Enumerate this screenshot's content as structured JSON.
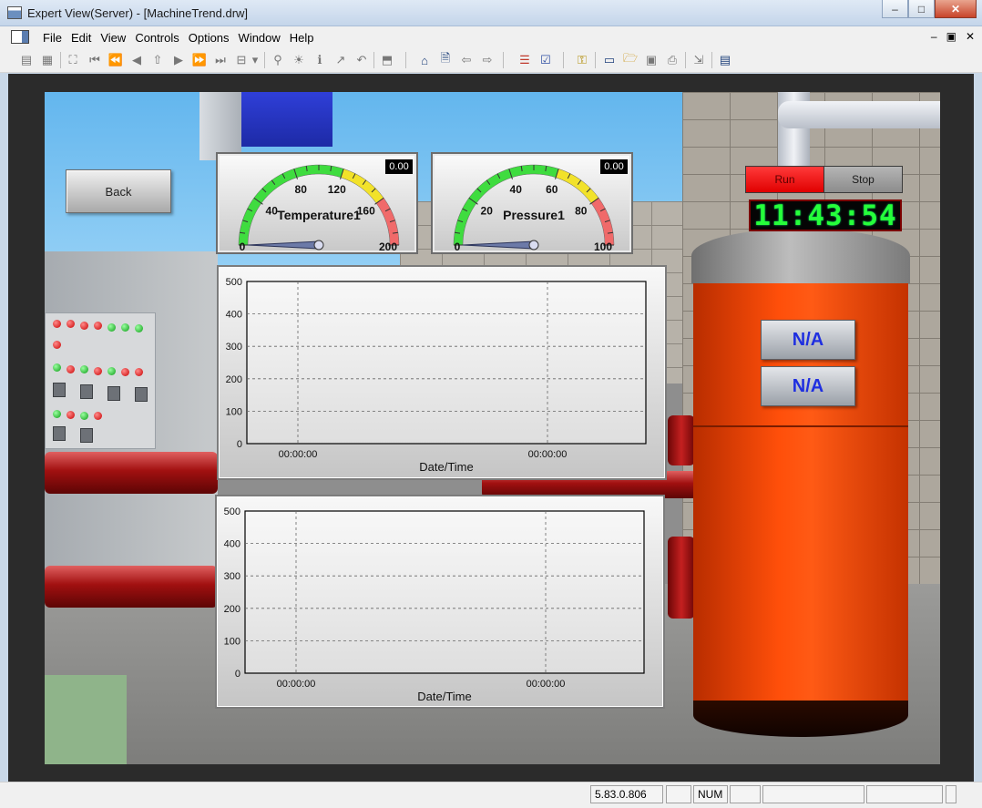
{
  "window": {
    "title": "Expert View(Server) - [MachineTrend.drw]",
    "minimize_glyph": "–",
    "maximize_glyph": "□",
    "close_glyph": "✕"
  },
  "menu": {
    "items": [
      "File",
      "Edit",
      "View",
      "Controls",
      "Options",
      "Window",
      "Help"
    ],
    "mdi_minimize": "–",
    "mdi_restore": "▣",
    "mdi_close": "✕"
  },
  "toolbar": {
    "icons": [
      "table-icon",
      "grid-icon",
      "fit-icon",
      "first-icon",
      "rewind-icon",
      "prev-icon",
      "tree-icon",
      "next-icon",
      "forward-icon",
      "last-icon",
      "frame-icon",
      "dropdown-icon",
      "zoom-icon",
      "bulb-icon",
      "info-icon",
      "chart-icon",
      "undo-icon",
      "folder-up-icon",
      "home-icon",
      "page-icon",
      "back-arrow-icon",
      "forward-arrow-icon",
      "list-icon",
      "check-list-icon",
      "key-icon",
      "window-icon",
      "open-folder-icon",
      "save-icon",
      "print-icon",
      "export-icon",
      "notes-icon"
    ]
  },
  "hmi": {
    "back_label": "Back",
    "gauges": [
      {
        "label": "Temperature1",
        "readout": "0.00",
        "min": 0,
        "max": 200,
        "ticks": [
          "0",
          "40",
          "80",
          "120",
          "160",
          "200"
        ],
        "value": 0,
        "zones": [
          {
            "from": 0,
            "to": 120,
            "color": "#3fdc3f"
          },
          {
            "from": 120,
            "to": 160,
            "color": "#f2e22a"
          },
          {
            "from": 160,
            "to": 200,
            "color": "#f06a6a"
          }
        ]
      },
      {
        "label": "Pressure1",
        "readout": "0.00",
        "min": 0,
        "max": 100,
        "ticks": [
          "0",
          "20",
          "40",
          "60",
          "80",
          "100"
        ],
        "value": 0,
        "zones": [
          {
            "from": 0,
            "to": 60,
            "color": "#3fdc3f"
          },
          {
            "from": 60,
            "to": 80,
            "color": "#f2e22a"
          },
          {
            "from": 80,
            "to": 100,
            "color": "#f06a6a"
          }
        ]
      }
    ],
    "run_label": "Run",
    "stop_label": "Stop",
    "clock": "11:43:54",
    "na_values": [
      "N/A",
      "N/A"
    ]
  },
  "chart_data": [
    {
      "type": "line",
      "title": "",
      "xlabel": "Date/Time",
      "ylabel": "",
      "ylim": [
        0,
        500
      ],
      "yticks": [
        "0",
        "100",
        "200",
        "300",
        "400",
        "500"
      ],
      "xticks": [
        "00:00:00",
        "00:00:00"
      ],
      "series": [],
      "grid": true
    },
    {
      "type": "line",
      "title": "",
      "xlabel": "Date/Time",
      "ylabel": "",
      "ylim": [
        0,
        500
      ],
      "yticks": [
        "0",
        "100",
        "200",
        "300",
        "400",
        "500"
      ],
      "xticks": [
        "00:00:00",
        "00:00:00"
      ],
      "series": [],
      "grid": true
    }
  ],
  "statusbar": {
    "version": "5.83.0.806",
    "num": "NUM"
  }
}
